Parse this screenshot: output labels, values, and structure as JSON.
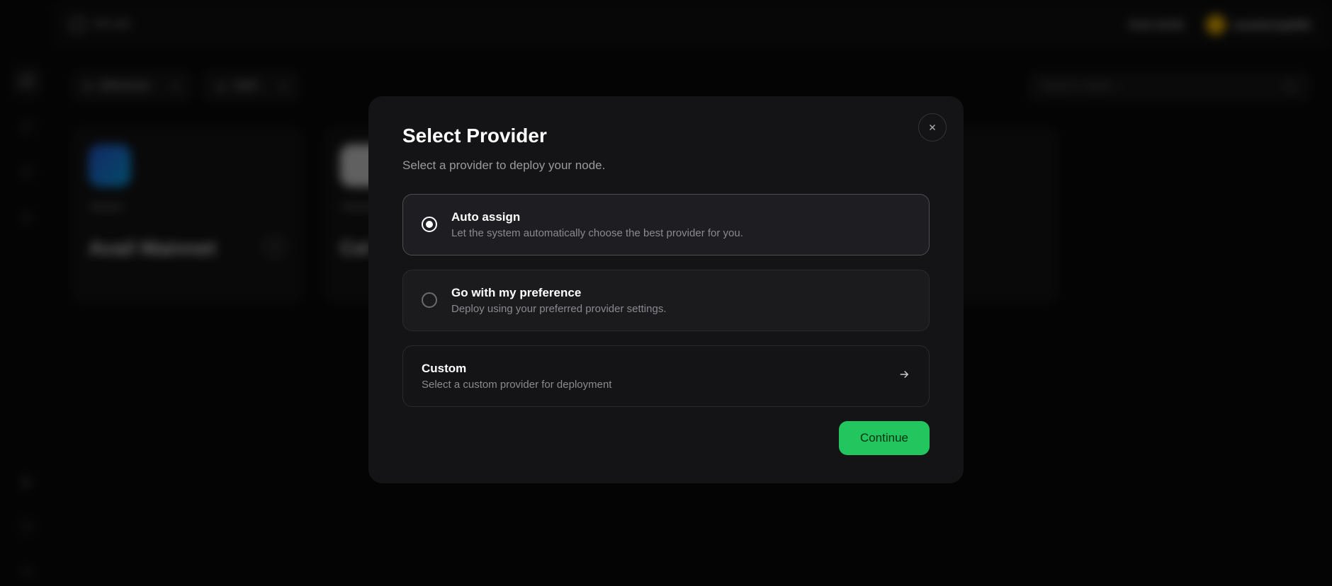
{
  "header": {
    "brand": "ATLAS",
    "run_node": "RUN NODE",
    "username": "mandelsingh950"
  },
  "filters": {
    "chain": "Ethereum",
    "category": "DeFi"
  },
  "search": {
    "placeholder": "Search nodes..."
  },
  "cards": [
    {
      "label": "Testnet",
      "title": "Avail Mainnet"
    },
    {
      "label": "Testnet",
      "title": "Cel"
    },
    {
      "label": "",
      "title": ""
    }
  ],
  "modal": {
    "title": "Select Provider",
    "subtitle": "Select a provider to deploy your node.",
    "options": [
      {
        "title": "Auto assign",
        "desc": "Let the system automatically choose the best provider for you."
      },
      {
        "title": "Go with my preference",
        "desc": "Deploy using your preferred provider settings."
      },
      {
        "title": "Custom",
        "desc": "Select a custom provider for deployment"
      }
    ],
    "continue": "Continue"
  }
}
